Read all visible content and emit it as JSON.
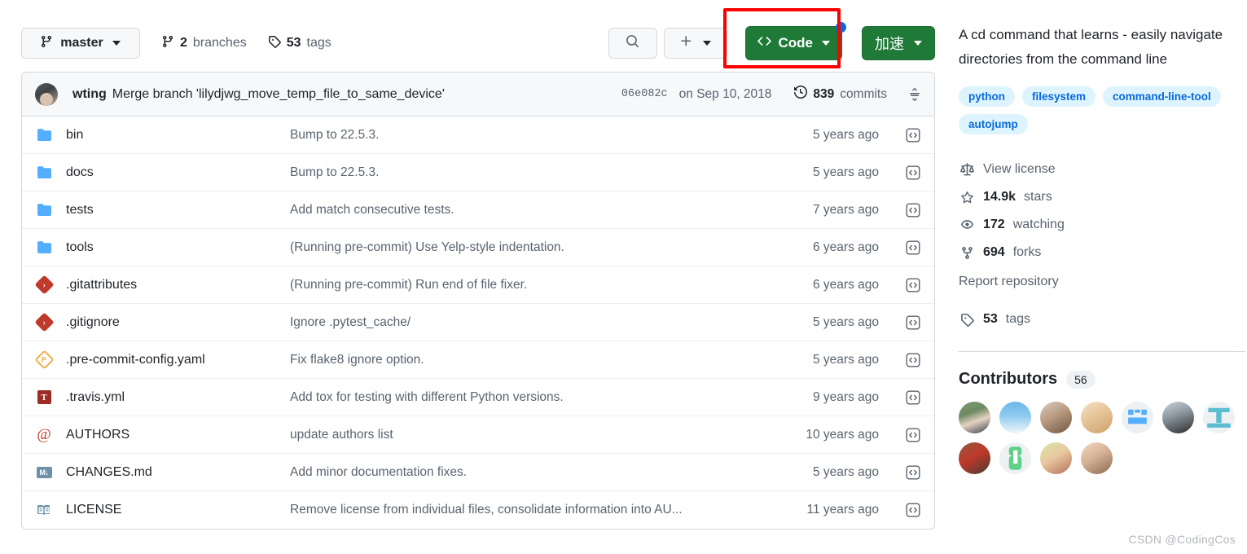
{
  "toolbar": {
    "branch": "master",
    "branches_count": "2",
    "branches_label": "branches",
    "tags_count": "53",
    "tags_label": "tags",
    "search_icon": "search-icon",
    "add_icon": "plus-icon",
    "code_button": "Code",
    "code_icon": "code-brackets-icon",
    "accelerate_button": "加速",
    "annotation_color": "#ff0000",
    "code_button_color": "#1f7a38",
    "badge_dot_color": "#0969da"
  },
  "commit_header": {
    "author": "wting",
    "message": "Merge branch 'lilydjwg_move_temp_file_to_same_device'",
    "sha": "06e082c",
    "date": "on Sep 10, 2018",
    "commits_count": "839",
    "commits_label": "commits",
    "history_icon": "history-clock-icon",
    "collapse_icon": "collapse-icon"
  },
  "files": [
    {
      "icon": "folder-icon",
      "type": "folder",
      "name": "bin",
      "message": "Bump to 22.5.3.",
      "age": "5 years ago"
    },
    {
      "icon": "folder-icon",
      "type": "folder",
      "name": "docs",
      "message": "Bump to 22.5.3.",
      "age": "5 years ago"
    },
    {
      "icon": "folder-icon",
      "type": "folder",
      "name": "tests",
      "message": "Add match consecutive tests.",
      "age": "7 years ago"
    },
    {
      "icon": "folder-icon",
      "type": "folder",
      "name": "tools",
      "message": "(Running pre-commit) Use Yelp-style indentation.",
      "age": "6 years ago"
    },
    {
      "icon": "git-file-icon",
      "type": "git",
      "glyph": "›",
      "name": ".gitattributes",
      "message": "(Running pre-commit) Run end of file fixer.",
      "age": "6 years ago"
    },
    {
      "icon": "git-file-icon",
      "type": "git",
      "glyph": "›",
      "name": ".gitignore",
      "message": "Ignore .pytest_cache/",
      "age": "5 years ago"
    },
    {
      "icon": "pre-commit-file-icon",
      "type": "pre",
      "glyph": "P",
      "name": ".pre-commit-config.yaml",
      "message": "Fix flake8 ignore option.",
      "age": "5 years ago"
    },
    {
      "icon": "travis-file-icon",
      "type": "travis",
      "glyph": "T",
      "name": ".travis.yml",
      "message": "Add tox for testing with different Python versions.",
      "age": "9 years ago"
    },
    {
      "icon": "authors-file-icon",
      "type": "at",
      "glyph": "@",
      "name": "AUTHORS",
      "message": "update authors list",
      "age": "10 years ago"
    },
    {
      "icon": "markdown-file-icon",
      "type": "md",
      "glyph": "M↓",
      "name": "CHANGES.md",
      "message": "Add minor documentation fixes.",
      "age": "5 years ago"
    },
    {
      "icon": "license-file-icon",
      "type": "license",
      "name": "LICENSE",
      "message": "Remove license from individual files, consolidate information into AU...",
      "age": "11 years ago"
    }
  ],
  "sidebar": {
    "description": "A cd command that learns - easily navigate directories from the command line",
    "topics": [
      "python",
      "filesystem",
      "command-line-tool",
      "autojump"
    ],
    "stats": [
      {
        "icon": "law-scale-icon",
        "value": "",
        "label": "View license"
      },
      {
        "icon": "star-icon",
        "value": "14.9k",
        "label": "stars"
      },
      {
        "icon": "eye-icon",
        "value": "172",
        "label": "watching"
      },
      {
        "icon": "fork-icon",
        "value": "694",
        "label": "forks"
      }
    ],
    "report_link": "Report repository",
    "tags_stat": {
      "icon": "tag-icon",
      "value": "53",
      "label": "tags"
    },
    "contributors_title": "Contributors",
    "contributors_count": "56",
    "contributor_avatars": [
      "contributor-avatar-1",
      "contributor-avatar-2",
      "contributor-avatar-3",
      "contributor-avatar-4",
      "contributor-avatar-5",
      "contributor-avatar-6",
      "contributor-avatar-7",
      "contributor-avatar-8",
      "contributor-avatar-9",
      "contributor-avatar-10",
      "contributor-avatar-11"
    ]
  },
  "watermark": "CSDN @CodingCos"
}
